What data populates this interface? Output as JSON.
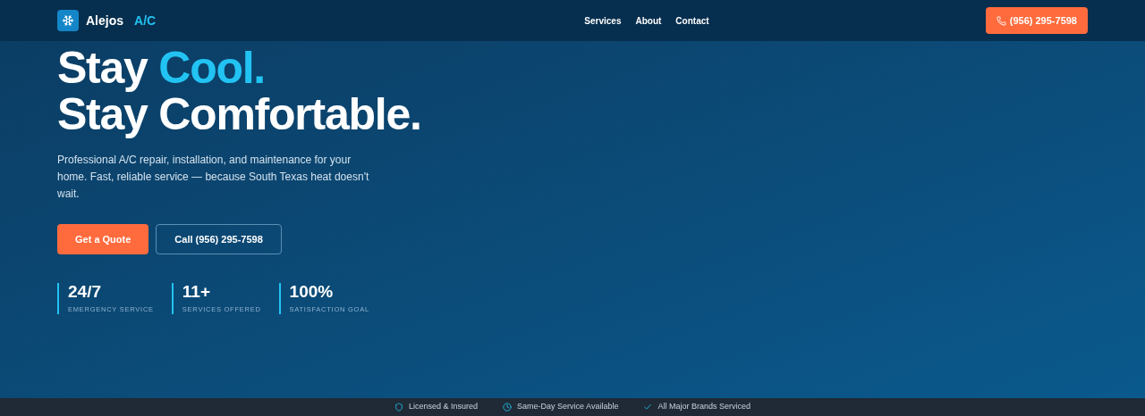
{
  "header": {
    "logo_name": "Alejos",
    "logo_suffix": "A/C",
    "nav": [
      "Services",
      "About",
      "Contact"
    ],
    "phone_button": "(956) 295-7598"
  },
  "hero": {
    "headline_start": "Stay",
    "headline_accent": "Cool.",
    "headline_line2": "Stay Comfortable.",
    "description": "Professional A/C repair, installation, and maintenance for your home. Fast, reliable service — because South Texas heat doesn't wait.",
    "buttons": [
      {
        "label": "Get a Quote",
        "kind": "primary"
      },
      {
        "label": "Call (956) 295-7598",
        "kind": "outline"
      }
    ],
    "stats": [
      {
        "value": "24/7",
        "label": "EMERGENCY SERVICE"
      },
      {
        "value": "11+",
        "label": "SERVICES OFFERED"
      },
      {
        "value": "100%",
        "label": "SATISFACTION GOAL"
      }
    ]
  },
  "trust_bar": [
    {
      "kind": "shield",
      "label": "Licensed & Insured"
    },
    {
      "kind": "clock",
      "label": "Same-Day Service Available"
    },
    {
      "kind": "check",
      "label": "All Major Brands Serviced"
    }
  ]
}
